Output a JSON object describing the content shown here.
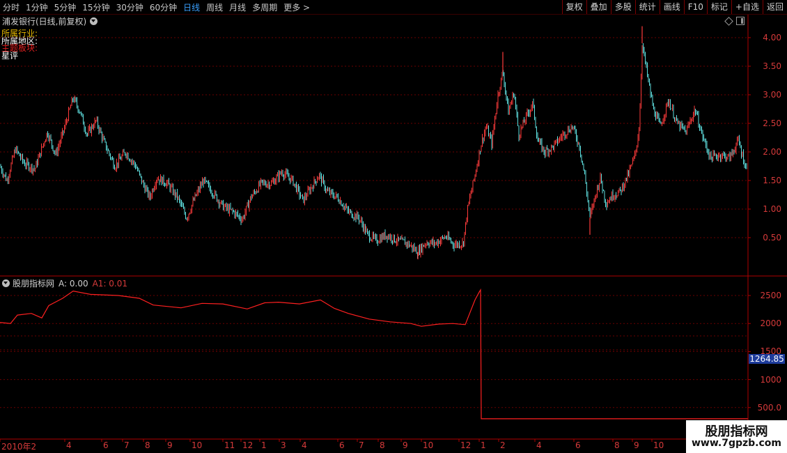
{
  "toolbar": {
    "periods": [
      "分时",
      "1分钟",
      "5分钟",
      "15分钟",
      "30分钟",
      "60分钟",
      "日线",
      "周线",
      "月线",
      "多周期",
      "更多 >"
    ],
    "selected_period": "日线",
    "right_buttons": [
      "复权",
      "叠加",
      "多股",
      "统计",
      "画线",
      "F10",
      "标记",
      "+自选",
      "返回"
    ]
  },
  "main_chart": {
    "title": "浦发银行(日线,前复权)",
    "info_lines": [
      {
        "text": "所属行业:",
        "color": "#e6b800"
      },
      {
        "text": "所属地区:",
        "color": "#ffffff"
      },
      {
        "text": "主题板块:",
        "color": "#e02020"
      },
      {
        "text": "星评",
        "color": "#ffffff"
      }
    ],
    "y_axis": [
      "4.00",
      "3.50",
      "3.00",
      "2.50",
      "2.00",
      "1.50",
      "1.00",
      "0.50"
    ]
  },
  "indicator": {
    "name": "股朋指标网",
    "a_label": "A: 0.00",
    "a1_label": "A1: 0.01",
    "y_axis": [
      "2500",
      "2000",
      "1500",
      "1000",
      "500.0"
    ],
    "current_price": "1264.85"
  },
  "x_axis": [
    "2010年2",
    "4",
    "6",
    "7",
    "8",
    "9",
    "10",
    "11",
    "12",
    "1",
    "3",
    "4",
    "6",
    "7",
    "8",
    "9",
    "10",
    "12",
    "1",
    "2",
    "4",
    "6",
    "8",
    "9",
    "10"
  ],
  "colors": {
    "up": "#ff3b3b",
    "down": "#5fe0e0",
    "axis": "#8b0000",
    "label": "#d63a3a",
    "selected": "#3aa0ff"
  },
  "watermark": {
    "line1": "股朋指标网",
    "line2": "www.7gpzb.com"
  },
  "chart_data": [
    {
      "type": "candlestick",
      "title": "浦发银行(日线,前复权)",
      "ylim": [
        0,
        4.3
      ],
      "x": [
        "2010-02",
        "2010-04",
        "2010-06",
        "2010-07",
        "2010-08",
        "2010-09",
        "2010-10",
        "2010-11",
        "2010-12",
        "2011-01",
        "2011-03",
        "2011-04",
        "2011-06",
        "2011-07",
        "2011-08",
        "2011-09",
        "2011-10",
        "2011-12",
        "2012-01",
        "2012-02",
        "2012-04",
        "2012-06",
        "2012-08",
        "2012-09",
        "2012-10"
      ],
      "close": [
        1.6,
        2.9,
        2.0,
        1.8,
        1.3,
        1.0,
        1.5,
        1.1,
        1.1,
        1.5,
        1.6,
        1.5,
        1.3,
        0.8,
        0.5,
        0.3,
        0.4,
        0.3,
        3.4,
        2.6,
        2.2,
        2.3,
        1.2,
        3.6,
        2.6
      ]
    },
    {
      "type": "line",
      "title": "股朋指标网",
      "ylim": [
        300,
        2750
      ],
      "values": [
        2020,
        2180,
        2560,
        2480,
        2400,
        2300,
        2250,
        2380,
        2300,
        2350,
        2380,
        2300,
        2180,
        2100,
        2050,
        1950,
        2000,
        2000,
        2580,
        50
      ],
      "last_value": 1264.85
    }
  ]
}
